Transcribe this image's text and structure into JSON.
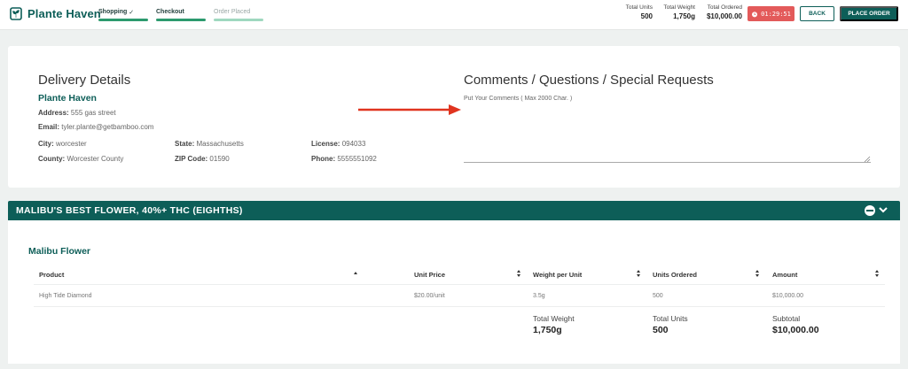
{
  "header": {
    "brand": "Plante Haven",
    "steps": [
      {
        "label": "Shopping",
        "done": true
      },
      {
        "label": "Checkout",
        "done": true
      },
      {
        "label": "Order Placed",
        "done": false
      }
    ],
    "stats": {
      "total_units_label": "Total Units",
      "total_units_value": "500",
      "total_weight_label": "Total Weight",
      "total_weight_value": "1,750g",
      "total_ordered_label": "Total Ordered",
      "total_ordered_value": "$10,000.00"
    },
    "timer": "01:29:51",
    "back_label": "BACK",
    "place_order_label": "PLACE ORDER"
  },
  "delivery": {
    "title": "Delivery Details",
    "store_name": "Plante Haven",
    "address_label": "Address:",
    "address_value": "555 gas street",
    "email_label": "Email:",
    "email_value": "tyler.plante@getbamboo.com",
    "city_label": "City:",
    "city_value": "worcester",
    "county_label": "County:",
    "county_value": "Worcester County",
    "state_label": "State:",
    "state_value": "Massachusetts",
    "zip_label": "ZIP Code:",
    "zip_value": "01590",
    "license_label": "License:",
    "license_value": "094033",
    "phone_label": "Phone:",
    "phone_value": "5555551092"
  },
  "comments": {
    "title": "Comments / Questions / Special Requests",
    "placeholder": "Put Your Comments ( Max 2000 Char. )",
    "value": ""
  },
  "section": {
    "title": "MALIBU'S BEST FLOWER, 40%+ THC (EIGHTHS)",
    "group_title": "Malibu Flower",
    "columns": [
      "Product",
      "Unit Price",
      "Weight per Unit",
      "Units Ordered",
      "Amount"
    ],
    "rows": [
      {
        "product": "High Tide Diamond",
        "unit_price": "$20.00/unit",
        "weight_per_unit": "3.5g",
        "units_ordered": "500",
        "amount": "$10,000.00"
      }
    ],
    "totals": {
      "weight_label": "Total Weight",
      "weight_value": "1,750g",
      "units_label": "Total Units",
      "units_value": "500",
      "subtotal_label": "Subtotal",
      "subtotal_value": "$10,000.00"
    }
  },
  "colors": {
    "brand": "#0d5e58",
    "progress": "#2c9a6e",
    "progress_pending": "#9fd8bf",
    "timer": "#e35a5a",
    "arrow": "#e0341f"
  },
  "icons": {
    "logo": "plant-logo-icon",
    "timer": "alarm-clock-icon",
    "check": "check-icon",
    "collapse": "chevron-down-icon",
    "badge": "minus-circle-icon",
    "sort": "sort-icon",
    "annotation": "arrow-right-icon"
  }
}
